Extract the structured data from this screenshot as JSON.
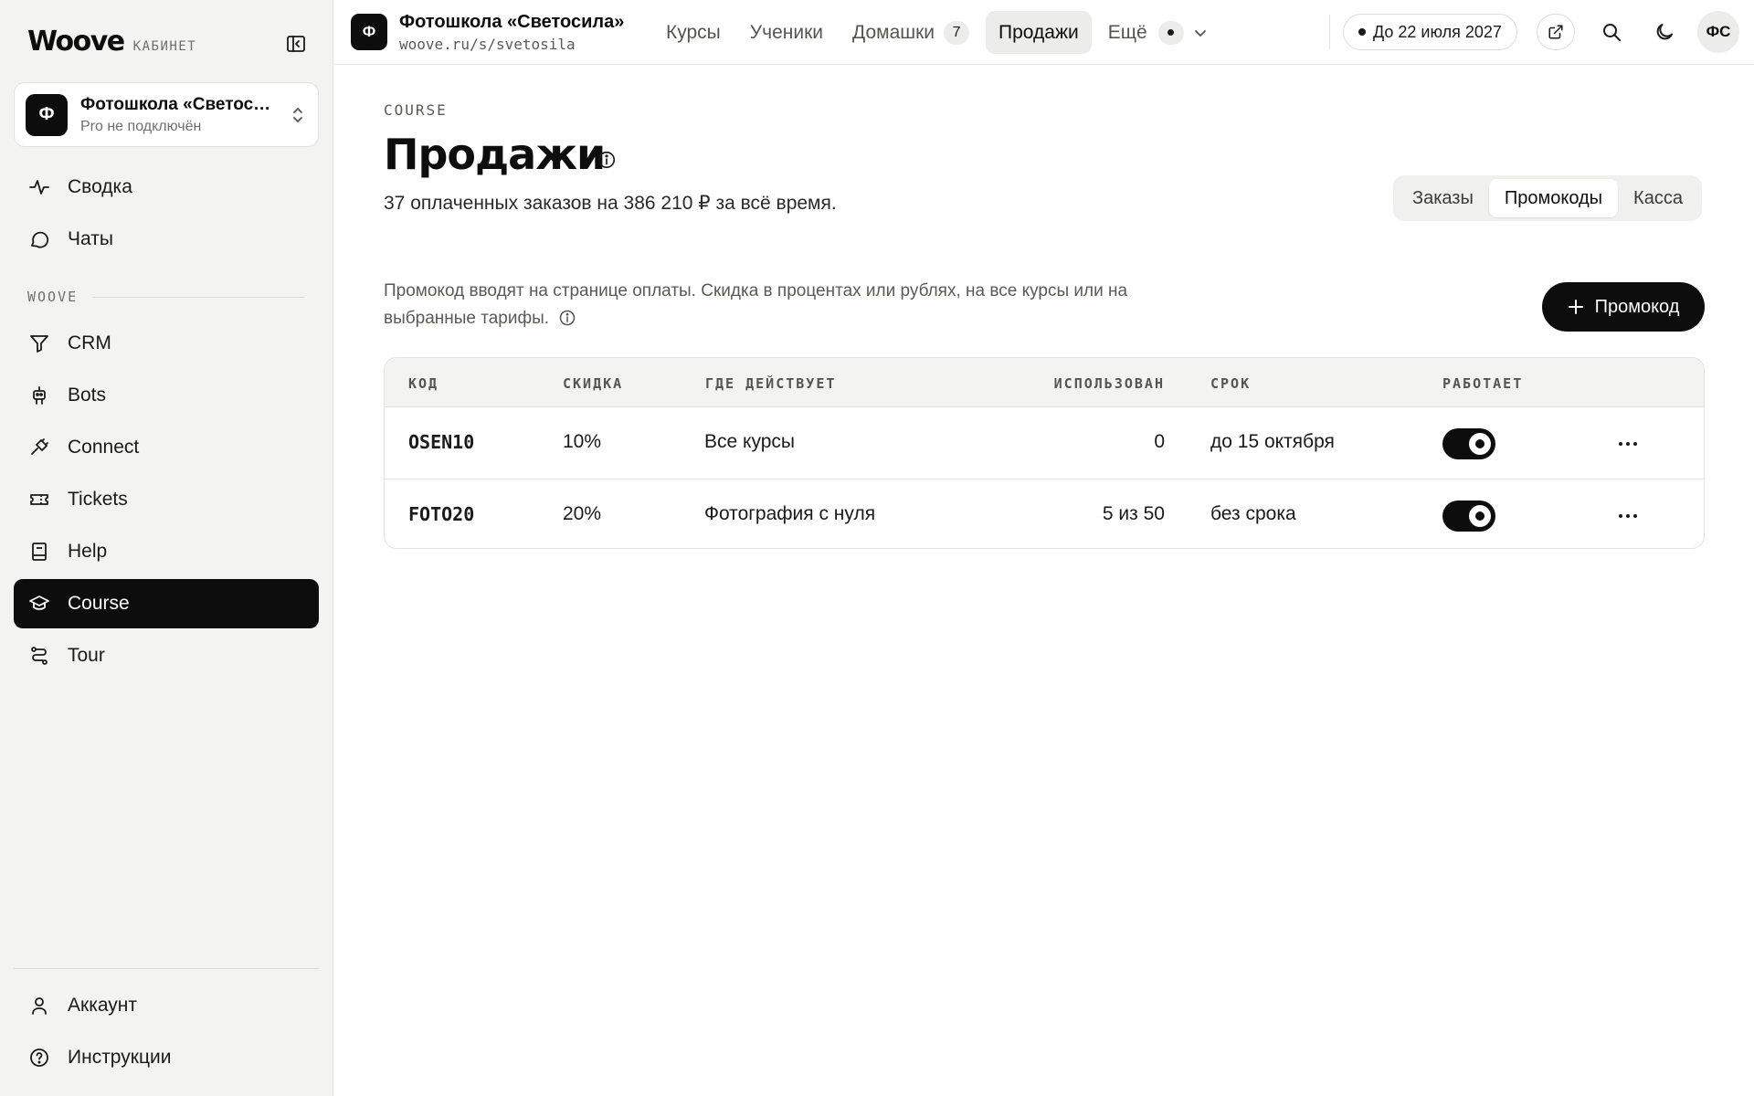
{
  "sidebar": {
    "brand": "Woove",
    "brand_sub": "КАБИНЕТ",
    "workspace": {
      "avatar": "Ф",
      "name": "Фотошкола «Светосила»",
      "status": "Pro не подключён"
    },
    "section_label": "WOOVE",
    "items": [
      {
        "label": "Сводка",
        "icon": "pulse-icon"
      },
      {
        "label": "Чаты",
        "icon": "chat-bubble-icon"
      },
      {
        "label": "CRM",
        "icon": "funnel-icon"
      },
      {
        "label": "Bots",
        "icon": "robot-icon"
      },
      {
        "label": "Connect",
        "icon": "plug-icon"
      },
      {
        "label": "Tickets",
        "icon": "ticket-icon"
      },
      {
        "label": "Help",
        "icon": "book-icon"
      },
      {
        "label": "Course",
        "icon": "graduation-cap-icon",
        "active": true
      },
      {
        "label": "Tour",
        "icon": "route-icon"
      }
    ],
    "footer": [
      {
        "label": "Аккаунт",
        "icon": "user-icon"
      },
      {
        "label": "Инструкции",
        "icon": "help-circle-icon"
      }
    ]
  },
  "topbar": {
    "site_avatar": "Ф",
    "site_name": "Фотошкола «Светосила»",
    "site_url": "woove.ru/s/svetosila",
    "nav": {
      "courses": "Курсы",
      "students": "Ученики",
      "homework": "Домашки",
      "homework_count": "7",
      "sales": "Продажи",
      "more": "Ещё"
    },
    "active_nav": "Продажи",
    "date_pill": "До 22 июля 2027",
    "user_initials": "ФС"
  },
  "main": {
    "eyebrow": "COURSE",
    "title": "Продажи",
    "summary": "37 оплаченных заказов на 386 210 ₽ за всё время.",
    "tabs": [
      "Заказы",
      "Промокоды",
      "Касса"
    ],
    "active_tab": "Промокоды",
    "description": "Промокод вводят на странице оплаты. Скидка в процентах или рублях, на все курсы или на выбранные тарифы.",
    "add_button": "Промокод",
    "table": {
      "columns": [
        "КОД",
        "СКИДКА",
        "ГДЕ ДЕЙСТВУЕТ",
        "ИСПОЛЬЗОВАН",
        "СРОК",
        "РАБОТАЕТ"
      ],
      "rows": [
        {
          "code": "OSEN10",
          "discount": "10%",
          "scope": "Все курсы",
          "used": "0",
          "term": "до 15 октября",
          "enabled": true
        },
        {
          "code": "FOTO20",
          "discount": "20%",
          "scope": "Фотография с нуля",
          "used": "5 из 50",
          "term": "без срока",
          "enabled": true
        }
      ]
    }
  },
  "colors": {
    "accent": "#0d0d0d",
    "sidebar_bg": "#f3f3f1",
    "muted_text": "#5a5a55"
  }
}
